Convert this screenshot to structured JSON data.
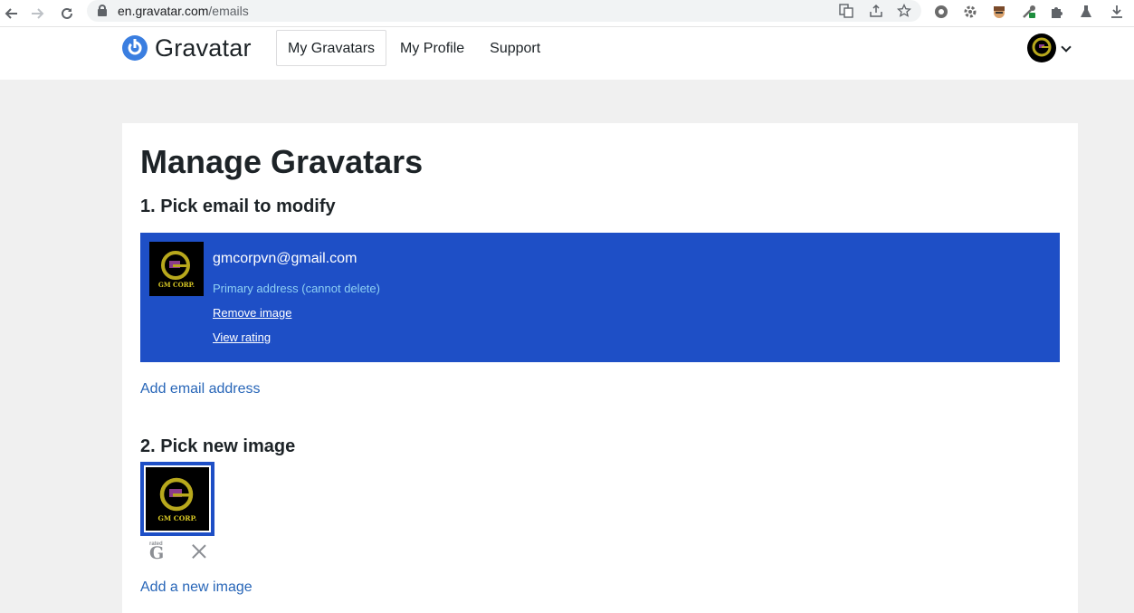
{
  "browser": {
    "url_host": "en.gravatar.com",
    "url_path": "/emails"
  },
  "header": {
    "logo_text": "Gravatar",
    "nav": [
      "My Gravatars",
      "My Profile",
      "Support"
    ],
    "active_nav": "My Gravatars"
  },
  "main": {
    "title": "Manage Gravatars",
    "step1_title": "1. Pick email to modify",
    "email": {
      "address": "gmcorpvn@gmail.com",
      "primary_note": "Primary address (cannot delete)",
      "remove_label": "Remove image",
      "rating_label": "View rating",
      "thumb_caption": "GM CORP."
    },
    "add_email_label": "Add email address",
    "step2_title": "2. Pick new image",
    "image": {
      "caption": "GM CORP.",
      "rating_small": "rated",
      "rating_letter": "G"
    },
    "add_image_label": "Add a new image"
  },
  "colors": {
    "selected_bg": "#1e4fc6",
    "link": "#2866b8",
    "primary_note": "#8ed0f4",
    "logo": "#3a7ee0"
  }
}
